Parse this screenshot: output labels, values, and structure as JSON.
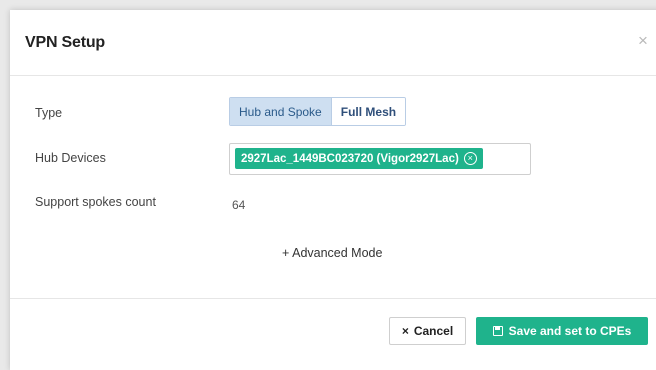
{
  "dialog": {
    "title": "VPN Setup",
    "close_glyph": "×"
  },
  "form": {
    "type_label": "Type",
    "type_options": [
      "Hub and Spoke",
      "Full Mesh"
    ],
    "type_selected": "Hub and Spoke",
    "hub_devices_label": "Hub Devices",
    "hub_device_chip": "2927Lac_1449BC023720 (Vigor2927Lac)",
    "chip_remove_glyph": "×",
    "support_spokes_label": "Support spokes count",
    "support_spokes_value": "64",
    "advanced_mode_glyph": "+",
    "advanced_mode_label": "Advanced Mode"
  },
  "footer": {
    "cancel_glyph": "×",
    "cancel_label": "Cancel",
    "save_label": "Save and set to CPEs"
  },
  "colors": {
    "accent_green": "#1fb38c",
    "segment_active_bg": "#cedff1"
  }
}
